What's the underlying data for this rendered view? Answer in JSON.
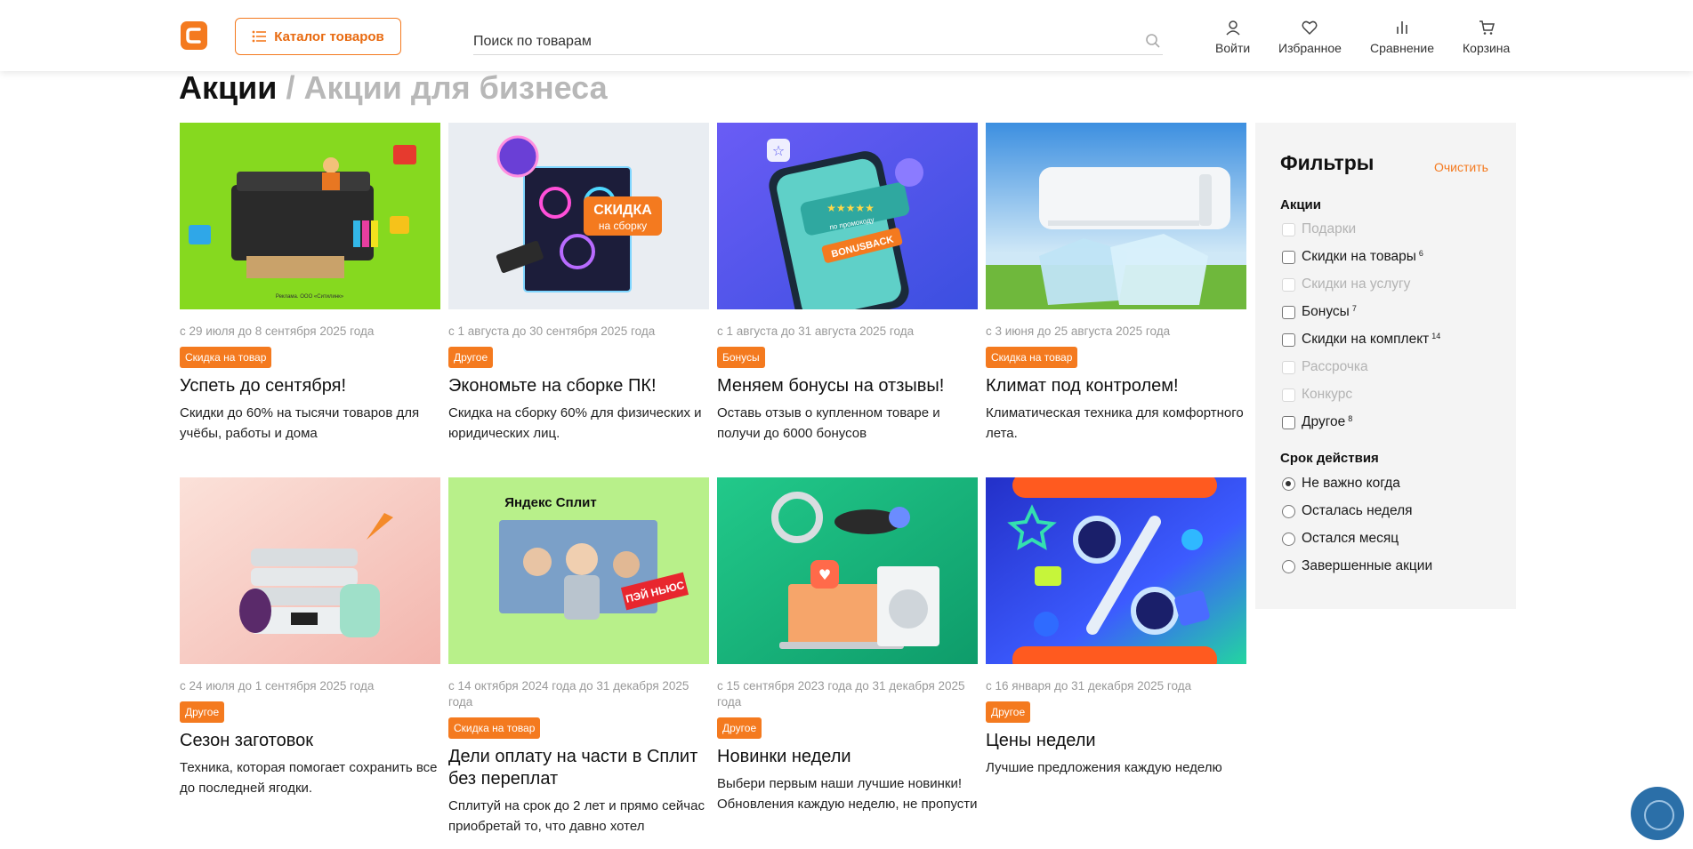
{
  "header": {
    "catalog_label": "Каталог товаров",
    "search_placeholder": "Поиск по товарам",
    "nav": {
      "login": "Войти",
      "favorites": "Избранное",
      "compare": "Сравнение",
      "cart": "Корзина"
    },
    "accent_color": "#f47a1f"
  },
  "breadcrumb": {
    "main": "Акции",
    "separator": "/",
    "sub": "Акции для бизнеса"
  },
  "promos": [
    {
      "date": "с 29 июля до 8 сентября 2025 года",
      "badge": "Скидка на товар",
      "title": "Успеть до сентября!",
      "desc": "Скидки до 60% на тысячи товаров для учёбы, работы и дома",
      "img_bg": "#7cd31a"
    },
    {
      "date": "с 1 августа до 30 сентября 2025 года",
      "badge": "Другое",
      "title": "Экономьте на сборке ПК!",
      "desc": "Скидка на сборку 60% для физических и юридических лиц.",
      "img_bg": "#e9edf2",
      "img_text_1": "СКИДКА",
      "img_text_2": "на сборку"
    },
    {
      "date": "с 1 августа до 31 августа 2025 года",
      "badge": "Бонусы",
      "title": "Меняем бонусы на отзывы!",
      "desc": "Оставь отзыв о купленном товаре и получи до 6000 бонусов",
      "img_bg": "#5a5bf0",
      "img_text_1": "по промокоду",
      "img_text_2": "BONUSBACK"
    },
    {
      "date": "с 3 июня до 25 августа 2025 года",
      "badge": "Скидка на товар",
      "title": "Климат под контролем!",
      "desc": "Климатическая техника для комфортного лета.",
      "img_bg": "#7fb8e8"
    },
    {
      "date": "с 24 июля до 1 сентября 2025 года",
      "badge": "Другое",
      "title": "Сезон заготовок",
      "desc": "Техника, которая помогает сохранить все до последней ягодки.",
      "img_bg": "#f6c9c2"
    },
    {
      "date": "с 14 октября 2024 года до 31 декабря 2025 года",
      "badge": "Скидка на товар",
      "title": "Дели оплату на части в Сплит без переплат",
      "desc": "Сплитуй на срок до 2 лет и прямо сейчас приобретай то, что давно хотел",
      "img_bg": "#b8f08a",
      "img_text_1": "Яндекс Сплит",
      "img_text_2": "ПЭЙ НЬЮС"
    },
    {
      "date": "с 15 сентября 2023 года до 31 декабря 2025 года",
      "badge": "Другое",
      "title": "Новинки недели",
      "desc": "Выбери первым наши лучшие новинки! Обновления каждую неделю, не пропусти",
      "img_bg": "#1fbf83"
    },
    {
      "date": "с 16 января до 31 декабря 2025 года",
      "badge": "Другое",
      "title": "Цены недели",
      "desc": "Лучшие предложения каждую неделю",
      "img_bg": "#3a3bd6"
    }
  ],
  "filters": {
    "title": "Фильтры",
    "clear": "Очистить",
    "group_promos": "Акции",
    "promo_options": [
      {
        "label": "Подарки",
        "count": "",
        "disabled": true
      },
      {
        "label": "Скидки на товары",
        "count": "6",
        "disabled": false
      },
      {
        "label": "Скидки на услугу",
        "count": "",
        "disabled": true
      },
      {
        "label": "Бонусы",
        "count": "7",
        "disabled": false
      },
      {
        "label": "Скидки на комплект",
        "count": "14",
        "disabled": false
      },
      {
        "label": "Рассрочка",
        "count": "",
        "disabled": true
      },
      {
        "label": "Конкурс",
        "count": "",
        "disabled": true
      },
      {
        "label": "Другое",
        "count": "8",
        "disabled": false
      }
    ],
    "group_period": "Срок действия",
    "period_options": [
      {
        "label": "Не важно когда",
        "selected": true
      },
      {
        "label": "Осталась неделя",
        "selected": false
      },
      {
        "label": "Остался месяц",
        "selected": false
      },
      {
        "label": "Завершенные акции",
        "selected": false
      }
    ]
  }
}
